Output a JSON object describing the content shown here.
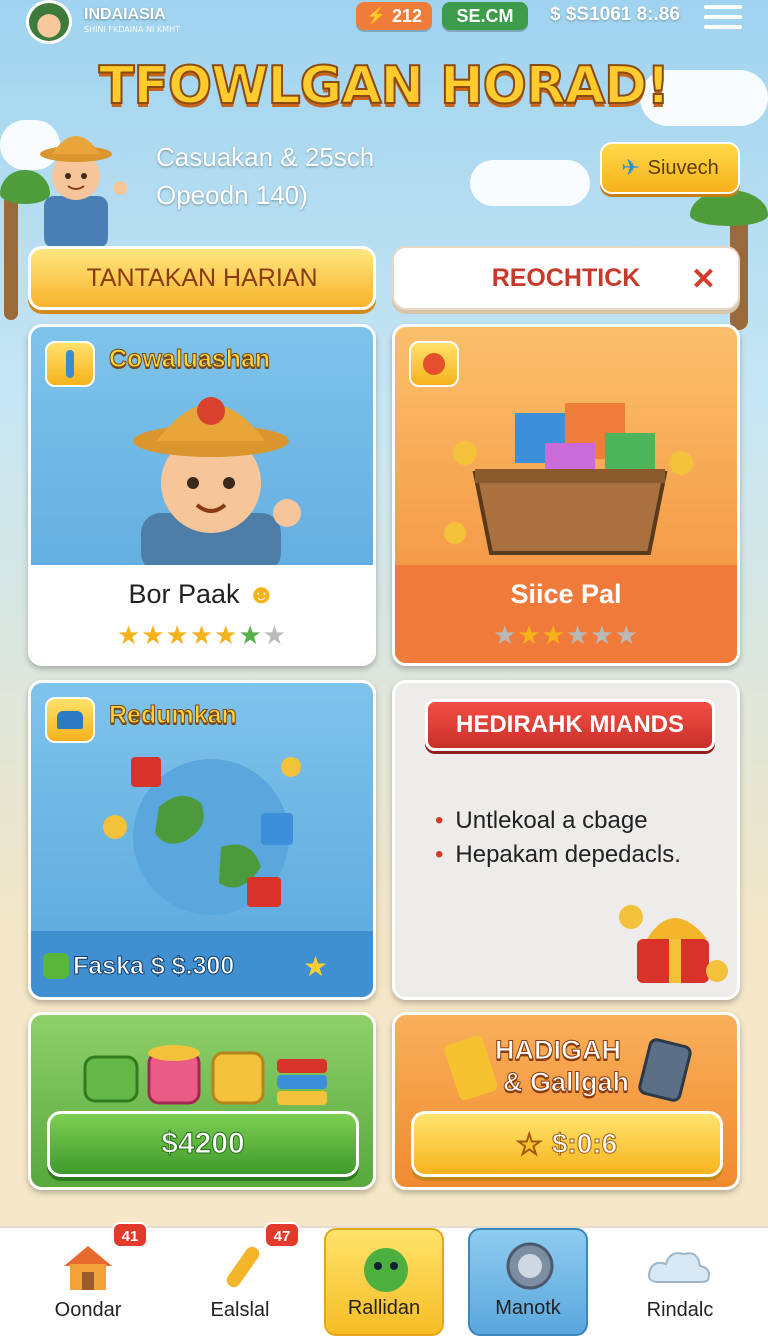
{
  "header": {
    "brand": "INDAIASIA",
    "brand_sub": "SHINI FKDAINA NI KMHT",
    "energy_badge": "212",
    "site_badge": "SE.CM",
    "balance": "$ $S1061 8:.86"
  },
  "title": "TFOWLGAN HORAD!",
  "subtitle": {
    "line1": "Casuakan & 25sch",
    "line2": "Opeodn 140)"
  },
  "search_button": "Siuvech",
  "tabs": {
    "daily": "TANTAKAN HARIAN",
    "other": "REOCHTICK",
    "close": "✕"
  },
  "cards": {
    "character": {
      "label": "Cowaluashan",
      "title": "Bor Paak",
      "rating": 5,
      "rating_max": 7
    },
    "chest": {
      "title": "Siice Pal",
      "rating": 3,
      "rating_max": 6
    },
    "world": {
      "label": "Redumkan",
      "price": "Faska $ $.300"
    },
    "rewards": {
      "banner": "HEDIRAHK MIANDS",
      "bullets": [
        "Untlekoal a cbage",
        "Hepakam depedacls."
      ]
    },
    "bundle": {
      "price": "$4200"
    },
    "gift": {
      "title_line1": "HADIGAH",
      "title_line2": "& Gallgah",
      "price": "$:0:6"
    }
  },
  "nav": [
    {
      "label": "Oondar",
      "badge": "41"
    },
    {
      "label": "Ealslal",
      "badge": "47"
    },
    {
      "label": "Rallidan"
    },
    {
      "label": "Manotk"
    },
    {
      "label": "Rindalc"
    }
  ],
  "colors": {
    "accent_yellow": "#f7b32b",
    "accent_orange": "#f08a30",
    "accent_blue": "#5aa6dd",
    "accent_green": "#58a83d",
    "alert_red": "#d23d2d"
  }
}
